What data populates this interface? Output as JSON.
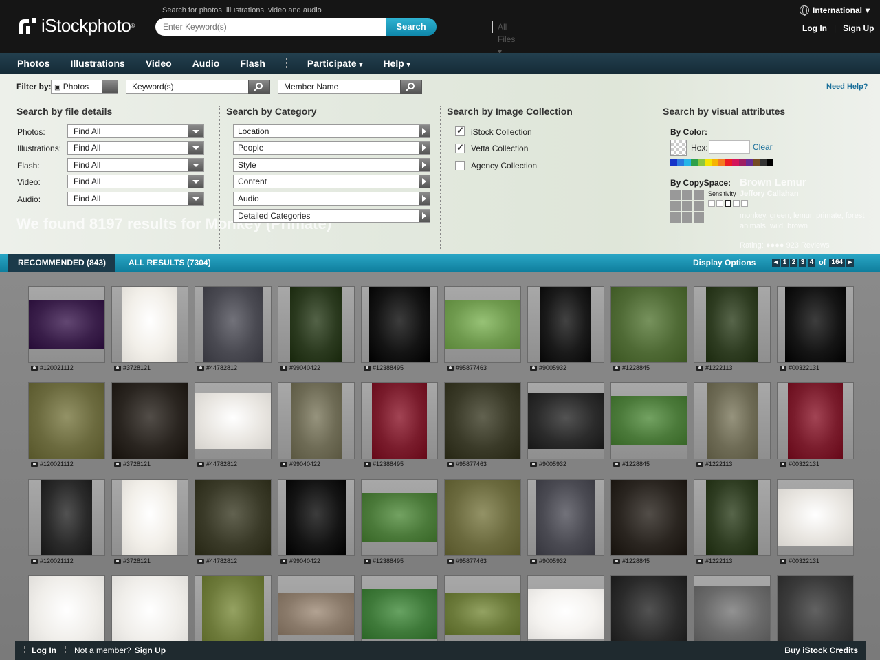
{
  "header": {
    "logo_text": "iStockphoto",
    "search_hint": "Search for photos, illustrations, video and audio",
    "search_placeholder": "Enter Keyword(s)",
    "file_type": "All Files",
    "search_button": "Search",
    "international": "International",
    "login": "Log In",
    "signup": "Sign Up"
  },
  "nav": {
    "items": [
      "Photos",
      "Illustrations",
      "Video",
      "Audio",
      "Flash"
    ],
    "participate": "Participate",
    "help": "Help"
  },
  "filter": {
    "label": "Filter by:",
    "type_value": "Photos",
    "keyword_placeholder": "Keyword(s)",
    "member_placeholder": "Member Name",
    "need_help": "Need Help?"
  },
  "file_details": {
    "title": "Search by file details",
    "rows": [
      {
        "label": "Photos:",
        "value": "Find All"
      },
      {
        "label": "Illustrations:",
        "value": "Find All"
      },
      {
        "label": "Flash:",
        "value": "Find All"
      },
      {
        "label": "Video:",
        "value": "Find All"
      },
      {
        "label": "Audio:",
        "value": "Find All"
      }
    ]
  },
  "category": {
    "title": "Search by Category",
    "items": [
      "Location",
      "People",
      "Style",
      "Content",
      "Audio",
      "Detailed Categories"
    ]
  },
  "collection": {
    "title": "Search by Image Collection",
    "items": [
      {
        "label": "iStock Collection",
        "checked": true
      },
      {
        "label": "Vetta Collection",
        "checked": true
      },
      {
        "label": "Agency Collection",
        "checked": false
      }
    ]
  },
  "visual": {
    "title": "Search by visual attributes",
    "by_color": "By Color:",
    "hex_label": "Hex:",
    "clear": "Clear",
    "palette": [
      "#1434c8",
      "#2a7ae0",
      "#25b5e8",
      "#2ea04b",
      "#8cc63f",
      "#f4e400",
      "#f6b400",
      "#f47b20",
      "#ed1c24",
      "#d4145a",
      "#9e1f63",
      "#662d91",
      "#754c24",
      "#333333",
      "#000000"
    ],
    "by_copyspace": "By CopySpace:",
    "sensitivity": "Sensitivity"
  },
  "ghost": {
    "results": "We found 8197 results for Monkey (Primate)",
    "title": "Brown Lemur",
    "by": "Jeffory Callahan",
    "tags": "monkey, green, lemur, primate, forest animals, wild, brown",
    "rating": "Rating:",
    "reviews": "923 Reviews"
  },
  "tabs": {
    "recommended": "RECOMMENDED (843)",
    "all": "ALL RESULTS (7304)",
    "display_options": "Display Options",
    "pages": [
      "1",
      "2",
      "3",
      "4"
    ],
    "of": "of",
    "total": "164"
  },
  "grid": {
    "ids": [
      "#120021112",
      "#3728121",
      "#44782812",
      "#99040422",
      "#12388495",
      "#95877463",
      "#9005932",
      "#1228845",
      "#1222113",
      "#00322131"
    ],
    "thumb_colors": [
      [
        "#3a1f4a",
        "#f2efe9",
        "#4a4a52",
        "#2b3a1f",
        "#141414",
        "#6f9a4e",
        "#1a1a1a",
        "#4f6a35",
        "#2f3d22",
        "#151515"
      ],
      [
        "#6b6a3e",
        "#2a2520",
        "#e9e6e1",
        "#6e6b55",
        "#7a1c2c",
        "#3a3a28",
        "#2b2b2b",
        "#4b7a3a",
        "#6e6b55",
        "#7a1c2c"
      ],
      [
        "#2a2a2a",
        "#f2efe9",
        "#3a3a28",
        "#141414",
        "#4b7a3a",
        "#6b6a3e",
        "#4a4a52",
        "#2a2520",
        "#2f3d22",
        "#e9e6e1"
      ],
      [
        "#f0eeea",
        "#f0eeea",
        "#6d7a3a",
        "#8a7a6a",
        "#3f7a3a",
        "#6b7a3a",
        "#f5f3f0",
        "#2a2a2a",
        "#6a6a6a",
        "#3a3a3a"
      ]
    ],
    "thumb_sizes": [
      [
        [
          110,
          72
        ],
        [
          80,
          110
        ],
        [
          86,
          110
        ],
        [
          76,
          110
        ],
        [
          88,
          110
        ],
        [
          110,
          72
        ],
        [
          74,
          110
        ],
        [
          110,
          110
        ],
        [
          76,
          110
        ],
        [
          88,
          110
        ]
      ],
      [
        [
          110,
          110
        ],
        [
          110,
          110
        ],
        [
          110,
          82
        ],
        [
          74,
          110
        ],
        [
          80,
          110
        ],
        [
          110,
          110
        ],
        [
          110,
          82
        ],
        [
          110,
          72
        ],
        [
          74,
          110
        ],
        [
          80,
          110
        ]
      ],
      [
        [
          74,
          110
        ],
        [
          80,
          110
        ],
        [
          110,
          110
        ],
        [
          88,
          110
        ],
        [
          110,
          72
        ],
        [
          110,
          110
        ],
        [
          86,
          110
        ],
        [
          110,
          110
        ],
        [
          76,
          110
        ],
        [
          110,
          82
        ]
      ],
      [
        [
          110,
          110
        ],
        [
          110,
          110
        ],
        [
          90,
          110
        ],
        [
          110,
          62
        ],
        [
          110,
          72
        ],
        [
          110,
          62
        ],
        [
          110,
          72
        ],
        [
          110,
          110
        ],
        [
          110,
          82
        ],
        [
          110,
          110
        ]
      ]
    ]
  },
  "footer": {
    "login": "Log In",
    "not_member": "Not a member?",
    "signup": "Sign Up",
    "buy": "Buy iStock Credits"
  }
}
